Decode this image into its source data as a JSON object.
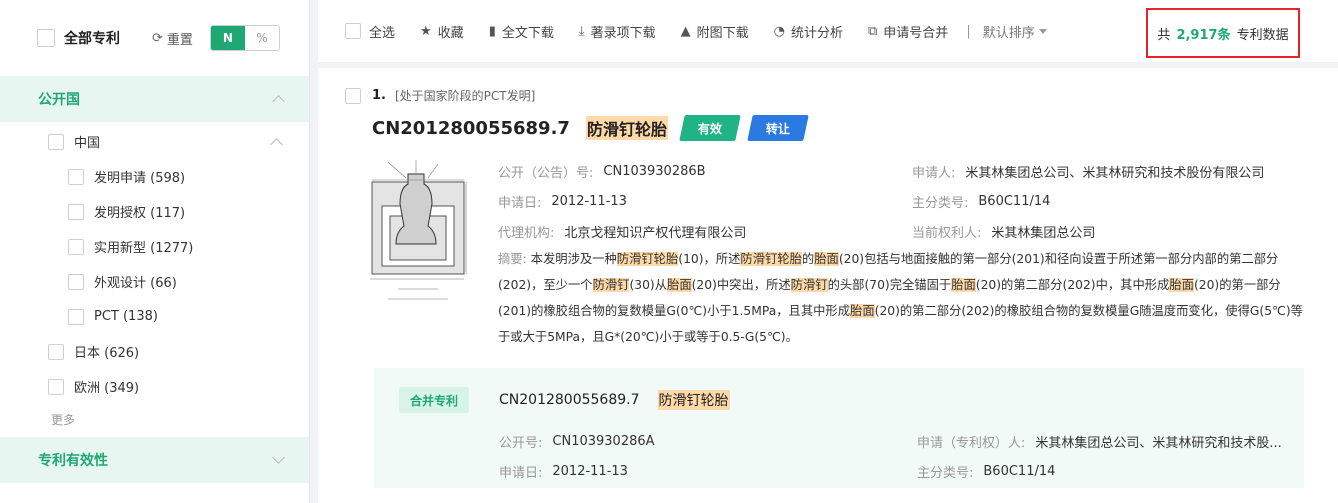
{
  "sidebar": {
    "all_label": "全部专利",
    "reset_label": "重置",
    "toggle_on": "N",
    "toggle_off": "%",
    "group1": "公开国",
    "country": "中国",
    "items": [
      {
        "label": "发明申请 (598)"
      },
      {
        "label": "发明授权 (117)"
      },
      {
        "label": "实用新型 (1277)"
      },
      {
        "label": "外观设计 (66)"
      },
      {
        "label": "PCT (138)"
      }
    ],
    "countries": [
      {
        "label": "日本 (626)"
      },
      {
        "label": "欧洲 (349)"
      }
    ],
    "more": "更多",
    "group2": "专利有效性"
  },
  "toolbar": {
    "select_all": "全选",
    "favorite": "收藏",
    "fulltext_download": "全文下载",
    "biblio_download": "著录项下载",
    "figure_download": "附图下载",
    "stats": "统计分析",
    "merge": "申请号合并",
    "sort": "默认排序"
  },
  "count": {
    "prefix": "共",
    "number": "2,917条",
    "suffix": "专利数据"
  },
  "result": {
    "index": "1.",
    "stage": "[处于国家阶段的PCT发明]",
    "number": "CN201280055689.7",
    "title": "防滑钉轮胎",
    "tag_valid": "有效",
    "tag_transfer": "转让",
    "pub_label": "公开（公告）号:",
    "pub_value": "CN103930286B",
    "app_date_label": "申请日:",
    "app_date_value": "2012-11-13",
    "agency_label": "代理机构:",
    "agency_value": "北京戈程知识产权代理有限公司",
    "applicant_label": "申请人:",
    "applicant_value": "米其林集团总公司、米其林研究和技术股份有限公司",
    "ipc_label": "主分类号:",
    "ipc_value": "B60C11/14",
    "owner_label": "当前权利人:",
    "owner_value": "米其林集团总公司",
    "abstract_label": "摘要:",
    "abstract_parts": [
      "本发明涉及一种",
      "防滑钉轮胎",
      "(10)，所述",
      "防滑钉轮胎",
      "的",
      "胎面",
      "(20)包括与地面接触的第一部分(201)和径向设置于所述第一部分内部的第二部分(202)，至少一个",
      "防滑钉",
      "(30)从",
      "胎面",
      "(20)中突出，所述",
      "防滑钉",
      "的头部(70)完全锚固于",
      "胎面",
      "(20)的第二部分(202)中，其中形成",
      "胎面",
      "(20)的第一部分(201)的橡胶组合物的复数模量G(0℃)小于1.5MPa，且其中形成",
      "胎面",
      "(20)的第二部分(202)的橡胶组合物的复数模量G随温度而变化，使得G(5℃)等于或大于5MPa，且G*(20℃)小于或等于0.5-G(5℃)。"
    ]
  },
  "merged": {
    "tag": "合并专利",
    "number": "CN201280055689.7",
    "title": "防滑钉轮胎",
    "pub_label": "公开号:",
    "pub_value": "CN103930286A",
    "app_date_label": "申请日:",
    "app_date_value": "2012-11-13",
    "applicant_label": "申请（专利权）人:",
    "applicant_value": "米其林集团总公司、米其林研究和技术股...",
    "ipc_label": "主分类号:",
    "ipc_value": "B60C11/14"
  },
  "colors": {
    "accent": "#20a874",
    "highlight": "#ffd9a8",
    "blue_tag": "#2a7ae2",
    "red_box": "#e8242b"
  }
}
